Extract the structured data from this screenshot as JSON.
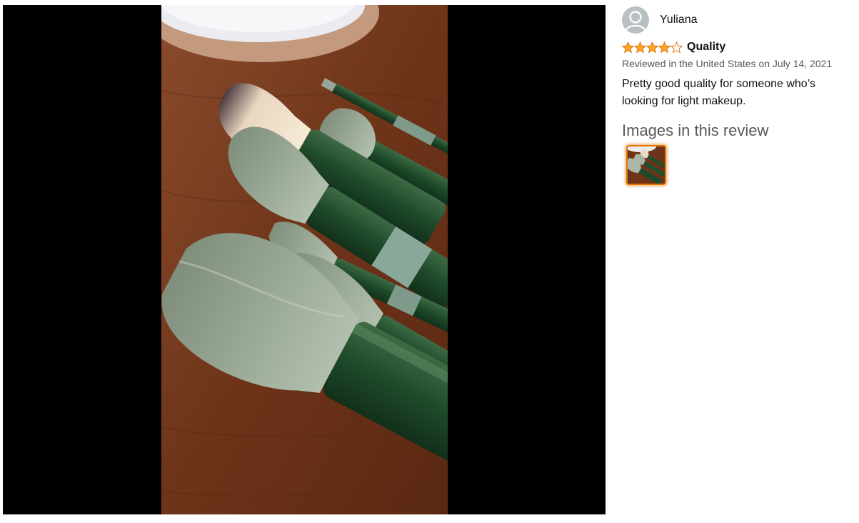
{
  "viewer": {
    "image_alt": "Customer image: green makeup brushes on a wooden table"
  },
  "review": {
    "author": "Yuliana",
    "rating": 4,
    "rating_max": 5,
    "title": "Quality",
    "date_line": "Reviewed in the United States on July 14, 2021",
    "body": "Pretty good quality for someone who’s looking for light makeup."
  },
  "images_section": {
    "heading": "Images in this review",
    "thumbnails": [
      {
        "alt": "Customer image thumbnail",
        "selected": true
      }
    ]
  },
  "colors": {
    "star_fill": "#ffa41c",
    "star_outline": "#de7921",
    "thumb_border": "#e77600"
  }
}
